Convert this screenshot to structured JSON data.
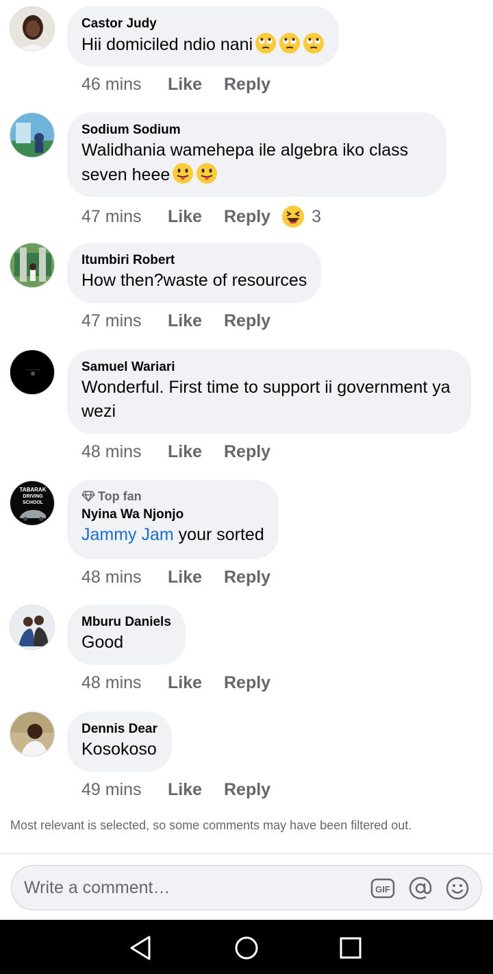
{
  "comments": [
    {
      "name": "Castor Judy",
      "text": "Hii domiciled ndio nani",
      "time": "46 mins",
      "emojis": [
        "rolling-eyes",
        "rolling-eyes",
        "rolling-eyes"
      ]
    },
    {
      "name": "Sodium Sodium",
      "text": "Walidhania wamehepa ile algebra iko class seven heee",
      "time": "47 mins",
      "emojis": [
        "tongue",
        "tongue"
      ],
      "reaction_count": "3"
    },
    {
      "name": "Itumbiri Robert",
      "text": "How then?waste of resources",
      "time": "47 mins"
    },
    {
      "name": "Samuel Wariari",
      "text": "Wonderful. First time to support ii government ya wezi",
      "time": "48 mins"
    },
    {
      "badge": "Top fan",
      "name": "Nyina Wa Njonjo",
      "mention": "Jammy Jam",
      "text": " your sorted",
      "time": "48 mins"
    },
    {
      "name": "Mburu Daniels",
      "text": "Good",
      "time": "48 mins"
    },
    {
      "name": "Dennis Dear",
      "text": "Kosokoso",
      "time": "49 mins"
    }
  ],
  "actions": {
    "like": "Like",
    "reply": "Reply"
  },
  "avatar_logo_text": "TABARAK DRIVING SCHOOL",
  "notice": "Most relevant is selected, so some comments may have been filtered out.",
  "composer": {
    "placeholder": "Write a comment…",
    "gif_label": "GIF"
  },
  "colors": {
    "bubble": "#f0f2f5",
    "meta": "#65676b",
    "mention": "#1b6fc9",
    "navbar": "#000000"
  }
}
